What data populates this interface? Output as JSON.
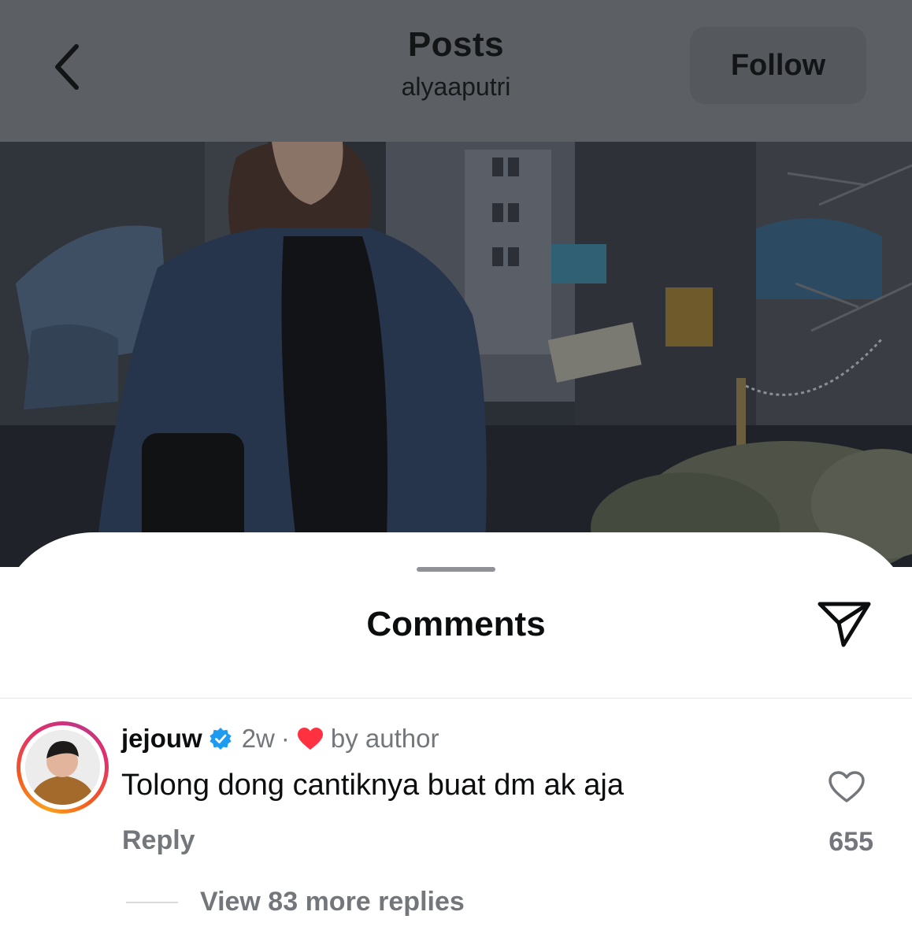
{
  "header": {
    "title": "Posts",
    "username": "alyaaputri",
    "follow_label": "Follow",
    "back_icon": "chevron-left-icon"
  },
  "comments_sheet": {
    "title": "Comments",
    "share_icon": "paper-plane-icon"
  },
  "comment": {
    "username": "jejouw",
    "verified": true,
    "time": "2w",
    "separator": "·",
    "liked_by_author_label": "by author",
    "text": "Tolong dong cantiknya buat dm ak aja",
    "reply_label": "Reply",
    "like_count": "655",
    "view_replies_label": "View 83 more replies"
  },
  "colors": {
    "verified_blue": "#1d9bf0",
    "heart_red": "#ff3040",
    "muted_text": "#73777c",
    "overlay_dim": "#5c5f63"
  }
}
